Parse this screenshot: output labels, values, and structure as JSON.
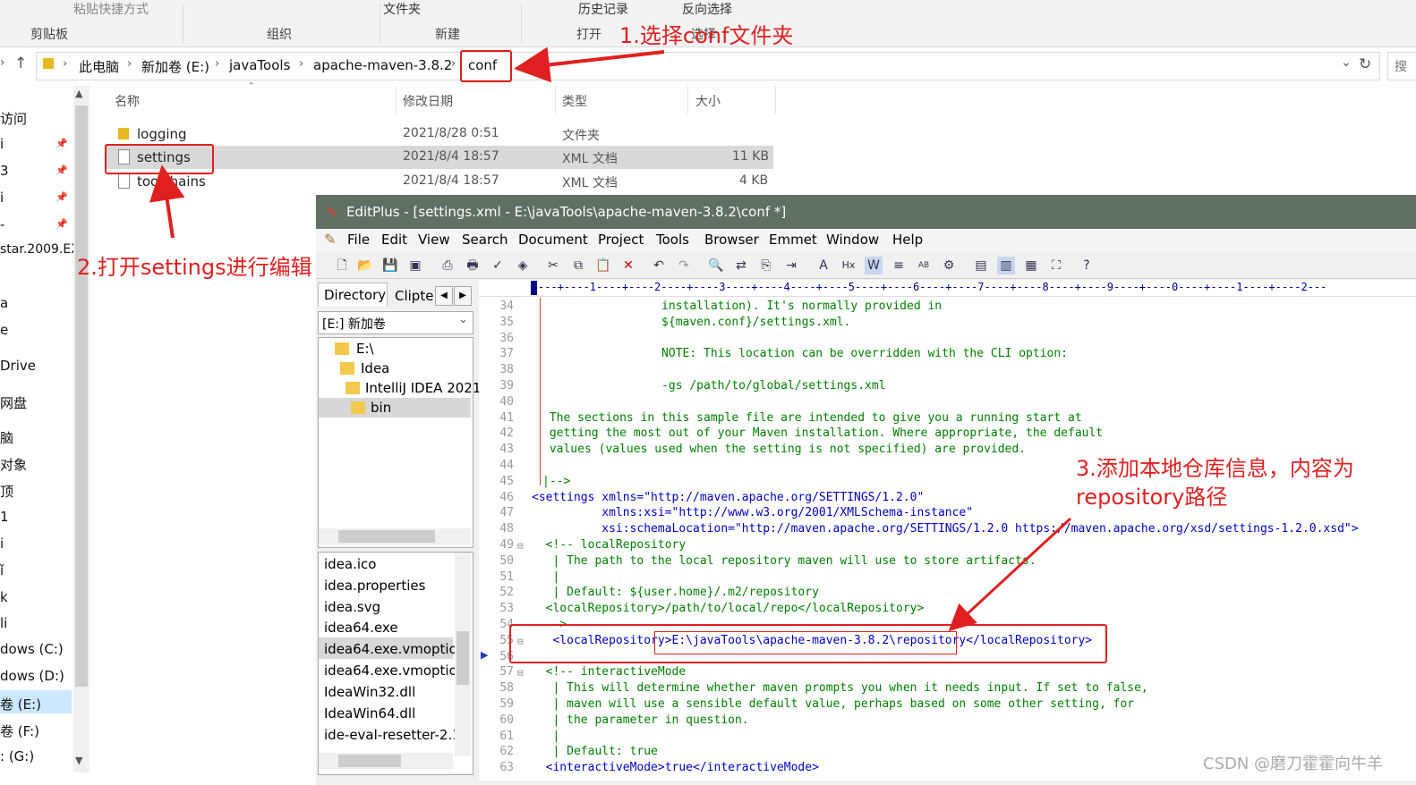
{
  "ribbon": {
    "top_items": [
      "粘贴快捷方式",
      "文件夹",
      "历史记录",
      "反向选择"
    ],
    "groups": [
      "剪贴板",
      "组织",
      "新建",
      "打开",
      "选择"
    ]
  },
  "address": {
    "crumbs": [
      "此电脑",
      "新加卷 (E:)",
      "javaTools",
      "apache-maven-3.8.2",
      "conf"
    ],
    "search_stub": "搜"
  },
  "nav": {
    "items": [
      "访问",
      "i",
      "3",
      "i",
      "-",
      "star.2009.EX",
      "a",
      "e",
      "Drive",
      "网盘",
      "脑",
      "对象",
      "顶",
      "1",
      "i",
      "ǐ",
      "k",
      "li",
      "dows (C:)",
      "dows (D:)",
      "卷 (E:)",
      "卷 (F:)",
      ": (G:)"
    ]
  },
  "file_list": {
    "columns": [
      "名称",
      "修改日期",
      "类型",
      "大小"
    ],
    "rows": [
      {
        "name": "logging",
        "date": "2021/8/28 0:51",
        "type": "文件夹",
        "size": ""
      },
      {
        "name": "settings",
        "date": "2021/8/4 18:57",
        "type": "XML 文档",
        "size": "11 KB"
      },
      {
        "name": "toolchains",
        "date": "2021/8/4 18:57",
        "type": "XML 文档",
        "size": "4 KB"
      }
    ]
  },
  "editplus": {
    "title": "EditPlus - [settings.xml - E:\\javaTools\\apache-maven-3.8.2\\conf *]",
    "menu": [
      "File",
      "Edit",
      "View",
      "Search",
      "Document",
      "Project",
      "Tools",
      "Browser",
      "Emmet",
      "Window",
      "Help"
    ],
    "tabs": [
      "Directory",
      "Clipte"
    ],
    "drive": "[E:] 新加卷",
    "tree": [
      "E:\\",
      "Idea",
      "IntelliJ IDEA 2021",
      "bin"
    ],
    "files": [
      "idea.ico",
      "idea.properties",
      "idea.svg",
      "idea64.exe",
      "idea64.exe.vmoptio",
      "idea64.exe.vmoptio",
      "IdeaWin32.dll",
      "IdeaWin64.dll",
      "ide-eval-resetter-2.1"
    ],
    "ruler": "---+----1----+----2----+----3----+----4----+----5----+----6----+----7----+----8----+----9----+----0----+----1----+----2---",
    "lines": [
      {
        "n": "34",
        "text": "                 installation). It's normally provided in"
      },
      {
        "n": "35",
        "text": "                 ${maven.conf}/settings.xml."
      },
      {
        "n": "36",
        "text": ""
      },
      {
        "n": "37",
        "text": "                 NOTE: This location can be overridden with the CLI option:"
      },
      {
        "n": "38",
        "text": ""
      },
      {
        "n": "39",
        "text": "                 -gs /path/to/global/settings.xml"
      },
      {
        "n": "40",
        "text": ""
      },
      {
        "n": "41",
        "text": " The sections in this sample file are intended to give you a running start at"
      },
      {
        "n": "42",
        "text": " getting the most out of your Maven installation. Where appropriate, the default"
      },
      {
        "n": "43",
        "text": " values (values used when the setting is not specified) are provided."
      },
      {
        "n": "44",
        "text": ""
      },
      {
        "n": "45",
        "text": "|-->"
      },
      {
        "n": "46",
        "text": "<settings xmlns=\"http://maven.apache.org/SETTINGS/1.2.0\""
      },
      {
        "n": "47",
        "text": "          xmlns:xsi=\"http://www.w3.org/2001/XMLSchema-instance\""
      },
      {
        "n": "48",
        "text": "          xsi:schemaLocation=\"http://maven.apache.org/SETTINGS/1.2.0 https://maven.apache.org/xsd/settings-1.2.0.xsd\">"
      },
      {
        "n": "49",
        "text": "  <!-- localRepository"
      },
      {
        "n": "50",
        "text": "   | The path to the local repository maven will use to store artifacts."
      },
      {
        "n": "51",
        "text": "   |"
      },
      {
        "n": "52",
        "text": "   | Default: ${user.home}/.m2/repository"
      },
      {
        "n": "53",
        "text": "  <localRepository>/path/to/local/repo</localRepository>"
      },
      {
        "n": "54",
        "text": "  -->"
      },
      {
        "n": "55",
        "text": "   <localRepository>E:\\javaTools\\apache-maven-3.8.2\\repository</localRepository>"
      },
      {
        "n": "56",
        "text": ""
      },
      {
        "n": "57",
        "text": "  <!-- interactiveMode"
      },
      {
        "n": "58",
        "text": "   | This will determine whether maven prompts you when it needs input. If set to false,"
      },
      {
        "n": "59",
        "text": "   | maven will use a sensible default value, perhaps based on some other setting, for"
      },
      {
        "n": "60",
        "text": "   | the parameter in question."
      },
      {
        "n": "61",
        "text": "   |"
      },
      {
        "n": "62",
        "text": "   | Default: true"
      },
      {
        "n": "63",
        "text": "  <interactiveMode>true</interactiveMode>"
      }
    ]
  },
  "annotations": {
    "step1": "1.选择conf文件夹",
    "step2": "2.打开settings进行编辑",
    "step3_line1": "3.添加本地仓库信息，内容为",
    "step3_line2": "repository路径"
  },
  "watermark": "CSDN @磨刀霍霍向牛羊",
  "colors": {
    "annotation": "#e02020",
    "titlebar": "#5f7062",
    "comment": "#008000",
    "tag": "#0000c0",
    "string": "#c000c0"
  }
}
